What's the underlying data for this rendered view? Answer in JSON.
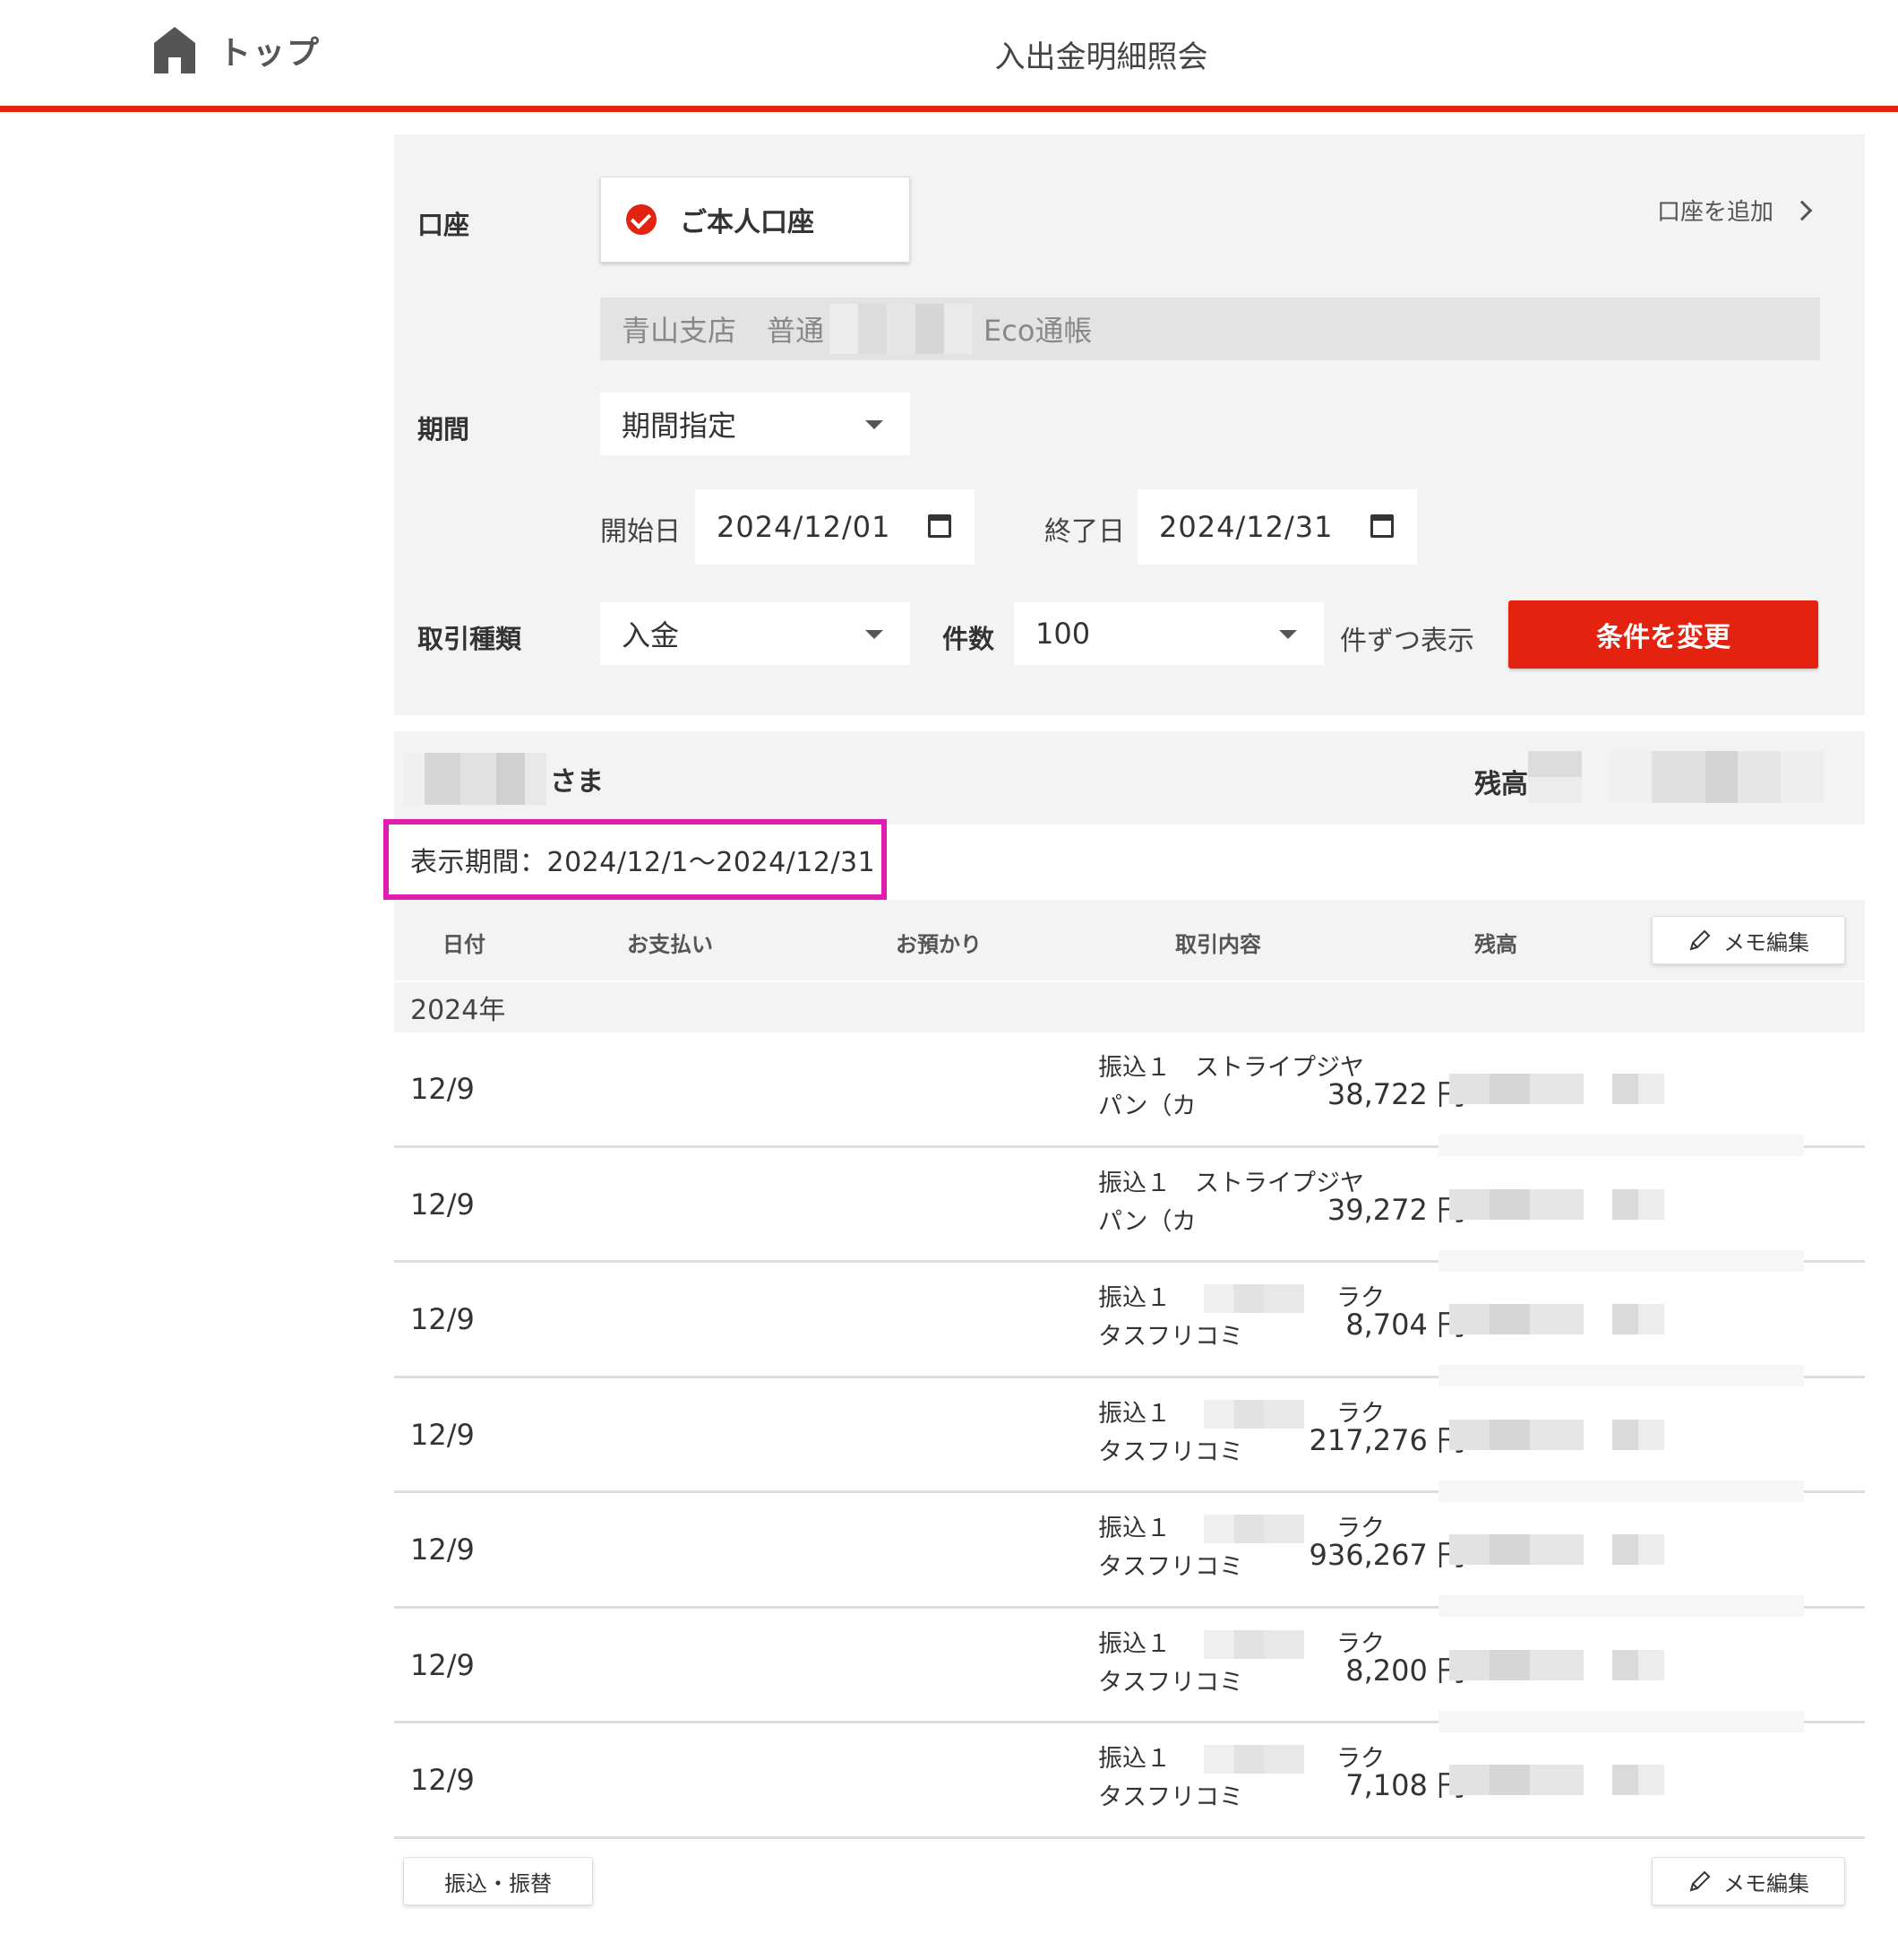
{
  "header": {
    "home_label": "トップ",
    "title": "入出金明細照会"
  },
  "filter": {
    "account_label": "口座",
    "own_account": "ご本人口座",
    "add_account": "口座を追加",
    "account_branch": "青山支店",
    "account_type": "普通",
    "account_book": "Eco通帳",
    "period_label": "期間",
    "period_value": "期間指定",
    "start_label": "開始日",
    "start_date": "2024/12/01",
    "end_label": "終了日",
    "end_date": "2024/12/31",
    "type_label": "取引種類",
    "type_value": "入金",
    "count_label": "件数",
    "count_value": "100",
    "per_page": "件ずつ表示",
    "apply_button": "条件を変更"
  },
  "holder": {
    "suffix": "さま",
    "balance_label": "残高"
  },
  "display_period": "表示期間：2024/12/1〜2024/12/31",
  "table": {
    "headers": {
      "date": "日付",
      "payment": "お支払い",
      "deposit": "お預かり",
      "content": "取引内容",
      "balance": "残高"
    },
    "memo_button": "メモ編集",
    "year": "2024年",
    "rows": [
      {
        "date": "12/9",
        "deposit": "38,722 円",
        "desc1": "振込１　ストライプジヤ",
        "desc2": "パン（カ",
        "masked": false
      },
      {
        "date": "12/9",
        "deposit": "39,272 円",
        "desc1": "振込１　ストライプジヤ",
        "desc2": "パン（カ",
        "masked": false
      },
      {
        "date": "12/9",
        "deposit": "8,704 円",
        "desc1": "振込１",
        "desc1b": "ラク",
        "desc2": "タスフリコミ",
        "masked": true
      },
      {
        "date": "12/9",
        "deposit": "217,276 円",
        "desc1": "振込１",
        "desc1b": "ラク",
        "desc2": "タスフリコミ",
        "masked": true
      },
      {
        "date": "12/9",
        "deposit": "936,267 円",
        "desc1": "振込１",
        "desc1b": "ラク",
        "desc2": "タスフリコミ",
        "masked": true
      },
      {
        "date": "12/9",
        "deposit": "8,200 円",
        "desc1": "振込１",
        "desc1b": "ラク",
        "desc2": "タスフリコミ",
        "masked": true
      },
      {
        "date": "12/9",
        "deposit": "7,108 円",
        "desc1": "振込１",
        "desc1b": "ラク",
        "desc2": "タスフリコミ",
        "masked": true
      }
    ]
  },
  "footer": {
    "transfer_button": "振込・振替",
    "memo_button": "メモ編集"
  },
  "colors": {
    "accent": "#e3220f",
    "highlight": "#e21cb3",
    "panel": "#f3f3f3"
  }
}
